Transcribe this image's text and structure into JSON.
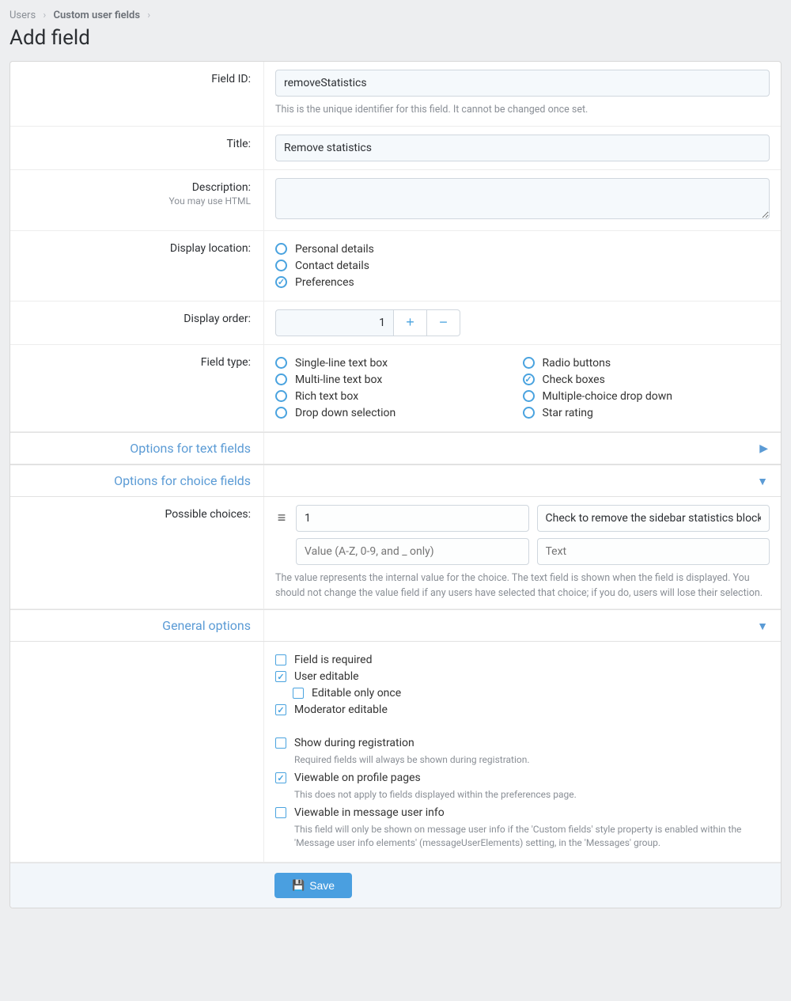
{
  "breadcrumb": {
    "item1": "Users",
    "item2": "Custom user fields"
  },
  "page_title": "Add field",
  "labels": {
    "field_id": "Field ID:",
    "title": "Title:",
    "description": "Description:",
    "description_sub": "You may use HTML",
    "display_location": "Display location:",
    "display_order": "Display order:",
    "field_type": "Field type:",
    "possible_choices": "Possible choices:"
  },
  "values": {
    "field_id": "removeStatistics",
    "title": "Remove statistics",
    "description": "",
    "display_order": "1",
    "choice1_value": "1",
    "choice1_text": "Check to remove the sidebar statistics block",
    "choice2_value": "",
    "choice2_text": ""
  },
  "placeholders": {
    "choice_value": "Value (A-Z, 0-9, and _ only)",
    "choice_text": "Text"
  },
  "hints": {
    "field_id": "This is the unique identifier for this field. It cannot be changed once set.",
    "choices": "The value represents the internal value for the choice. The text field is shown when the field is displayed. You should not change the value field if any users have selected that choice; if you do, users will lose their selection."
  },
  "display_location_options": {
    "personal": "Personal details",
    "contact": "Contact details",
    "preferences": "Preferences"
  },
  "field_type_options": {
    "single": "Single-line text box",
    "multi": "Multi-line text box",
    "rich": "Rich text box",
    "dropdown": "Drop down selection",
    "radio": "Radio buttons",
    "checkbox": "Check boxes",
    "multidrop": "Multiple-choice drop down",
    "star": "Star rating"
  },
  "sections": {
    "text_fields": "Options for text fields",
    "choice_fields": "Options for choice fields",
    "general": "General options"
  },
  "general": {
    "required": "Field is required",
    "user_editable": "User editable",
    "editable_once": "Editable only once",
    "mod_editable": "Moderator editable",
    "show_reg": "Show during registration",
    "show_reg_sub": "Required fields will always be shown during registration.",
    "viewable_profile": "Viewable on profile pages",
    "viewable_profile_sub": "This does not apply to fields displayed within the preferences page.",
    "viewable_msg": "Viewable in message user info",
    "viewable_msg_sub": "This field will only be shown on message user info if the 'Custom fields' style property is enabled within the 'Message user info elements' (messageUserElements) setting, in the 'Messages' group."
  },
  "buttons": {
    "save": "Save"
  }
}
